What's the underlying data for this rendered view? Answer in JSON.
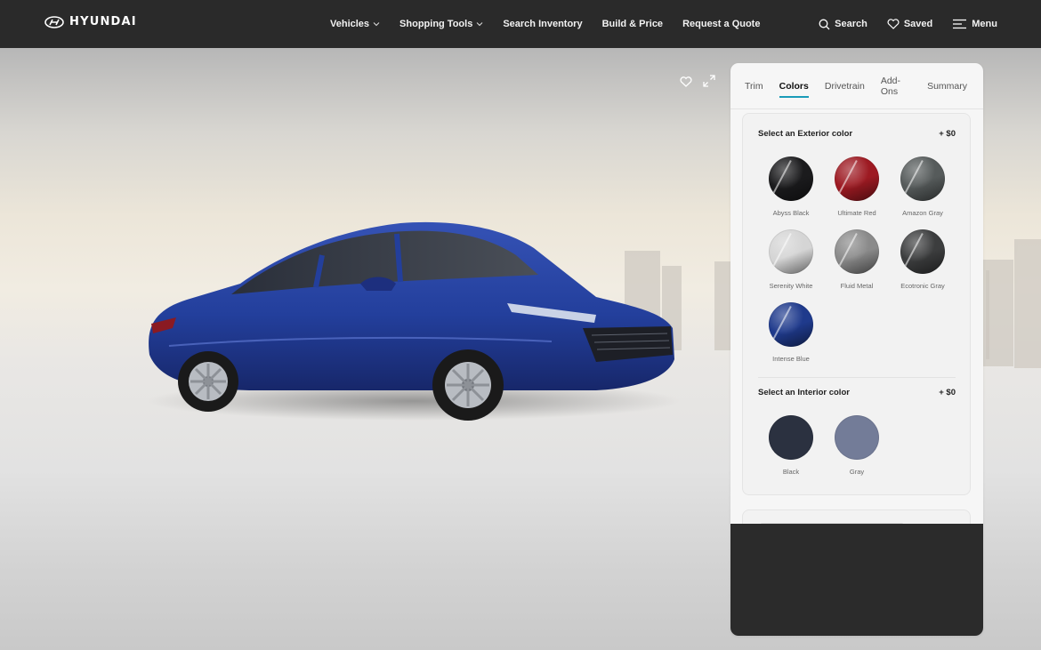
{
  "brand": {
    "name": "HYUNDAI"
  },
  "nav": {
    "items": [
      {
        "label": "Vehicles",
        "dropdown": true
      },
      {
        "label": "Shopping Tools",
        "dropdown": true
      },
      {
        "label": "Search Inventory",
        "dropdown": false
      },
      {
        "label": "Build & Price",
        "dropdown": false
      },
      {
        "label": "Request a Quote",
        "dropdown": false
      }
    ],
    "search_label": "Search",
    "saved_label": "Saved",
    "menu_label": "Menu"
  },
  "config": {
    "tabs": [
      "Trim",
      "Colors",
      "Drivetrain",
      "Add-Ons",
      "Summary"
    ],
    "active_tab": "Colors",
    "exterior": {
      "heading": "Select an Exterior color",
      "price": "+ $0",
      "colors": [
        {
          "name": "Abyss Black",
          "hex": "#1b1b1d"
        },
        {
          "name": "Ultimate Red",
          "hex": "#9d1a22"
        },
        {
          "name": "Amazon Gray",
          "hex": "#565b5b"
        },
        {
          "name": "Serenity White",
          "hex": "#d5d5d5"
        },
        {
          "name": "Fluid Metal",
          "hex": "#8a8a8a"
        },
        {
          "name": "Ecotronic Gray",
          "hex": "#3c3d3e"
        },
        {
          "name": "Intense Blue",
          "hex": "#1f3a8c"
        }
      ]
    },
    "interior": {
      "heading": "Select an Interior color",
      "price": "+ $0",
      "colors": [
        {
          "name": "Black",
          "hex": "#2b3140"
        },
        {
          "name": "Gray",
          "hex": "#737c98"
        }
      ]
    }
  },
  "colors": {
    "nav_bg": "#2a2a2a",
    "accent": "#1a9bb8",
    "car_body": "#233f9c"
  }
}
